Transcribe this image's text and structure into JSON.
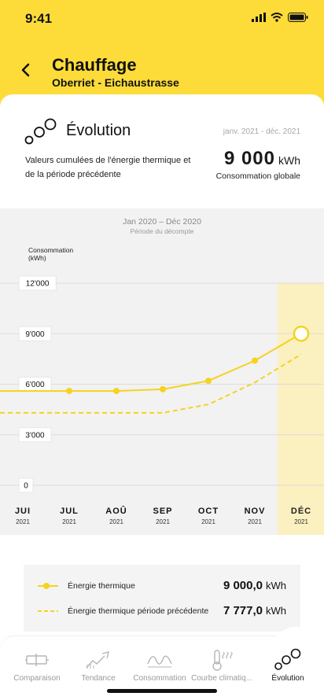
{
  "status_bar": {
    "time": "9:41"
  },
  "header": {
    "title": "Chauffage",
    "subtitle": "Oberriet - Eichaustrasse"
  },
  "evolution": {
    "title": "Évolution",
    "period": "janv. 2021 - déc. 2021",
    "description": "Valeurs cumulées de l'énergie thermique et de la période précédente",
    "total_value": "9 000",
    "total_unit": "kWh",
    "total_label": "Consommation globale"
  },
  "chart_header": {
    "period": "Jan 2020 – Déc 2020",
    "subtitle": "Période du décompte"
  },
  "chart_data": {
    "type": "line",
    "ylabel": "Consommation (kWh)",
    "ylim": [
      0,
      12000
    ],
    "yticks": [
      0,
      3000,
      6000,
      9000,
      12000
    ],
    "ytick_labels": [
      "0",
      "3'000",
      "6'000",
      "9'000",
      "12'000"
    ],
    "categories": [
      "JUI",
      "JUL",
      "AOÛ",
      "SEP",
      "OCT",
      "NOV",
      "DÉC"
    ],
    "category_years": [
      "2021",
      "2021",
      "2021",
      "2021",
      "2021",
      "2021",
      "2021"
    ],
    "highlighted_category": "DÉC",
    "series": [
      {
        "name": "Énergie thermique",
        "style": "solid",
        "color": "#f5d31e",
        "values": [
          5600,
          5600,
          5600,
          5700,
          6200,
          7400,
          9000
        ]
      },
      {
        "name": "Énergie thermique période précédente",
        "style": "dashed",
        "color": "#f5d31e",
        "values": [
          4300,
          4300,
          4300,
          4300,
          4800,
          6100,
          7777
        ]
      }
    ]
  },
  "legend": [
    {
      "name": "Énergie thermique",
      "value": "9 000,0",
      "unit": "kWh"
    },
    {
      "name": "Énergie thermique période précédente",
      "value": "7 777,0",
      "unit": "kWh"
    }
  ],
  "nav": [
    {
      "label": "Comparaison",
      "icon": "battery-icon",
      "active": false
    },
    {
      "label": "Tendance",
      "icon": "trend-icon",
      "active": false
    },
    {
      "label": "Consommation",
      "icon": "wave-icon",
      "active": false
    },
    {
      "label": "Courbe climatiq...",
      "icon": "thermometer-icon",
      "active": false
    },
    {
      "label": "Évolution",
      "icon": "bubbles-icon",
      "active": true
    }
  ],
  "colors": {
    "accent": "#fddc3a",
    "series": "#f5d31e",
    "highlight": "#fbf0c0"
  }
}
